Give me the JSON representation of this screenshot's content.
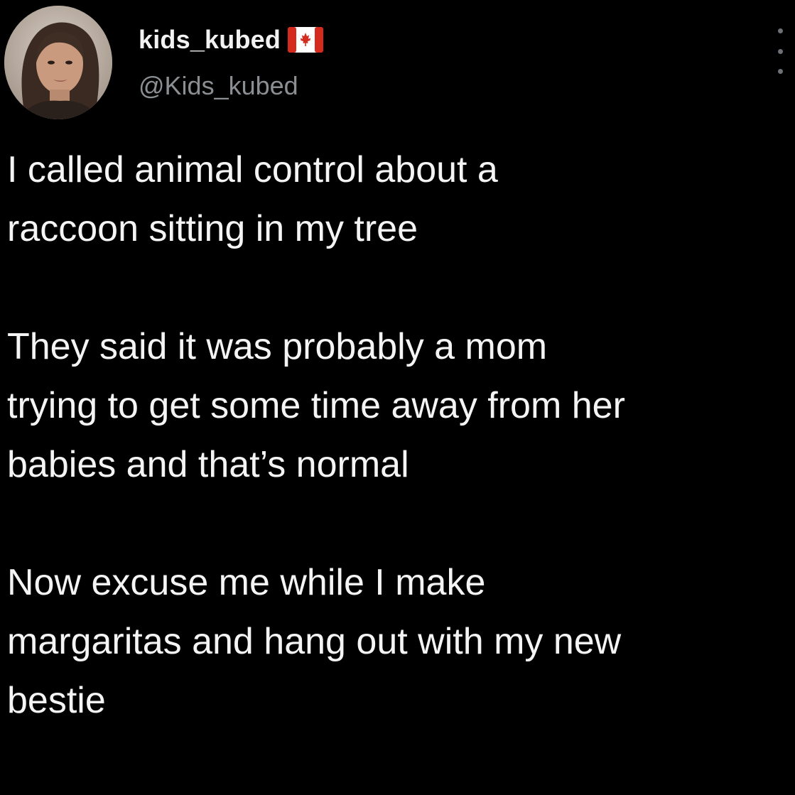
{
  "author": {
    "display_name": "kids_kubed",
    "handle": "@Kids_kubed",
    "flag_icon": "canada-flag-icon"
  },
  "tweet": {
    "paragraphs": [
      "I called animal control about a\nraccoon sitting in my tree",
      "They said it was probably a mom\ntrying to get some time away from her\nbabies and that’s normal",
      "Now excuse me while I make\nmargaritas and hang out with my new\nbestie"
    ]
  },
  "colors": {
    "background": "#000000",
    "text": "#f4f4f4",
    "handle": "#8b8f93",
    "flag_red": "#d52b1e"
  },
  "icons": {
    "more": "more-vertical-icon"
  }
}
